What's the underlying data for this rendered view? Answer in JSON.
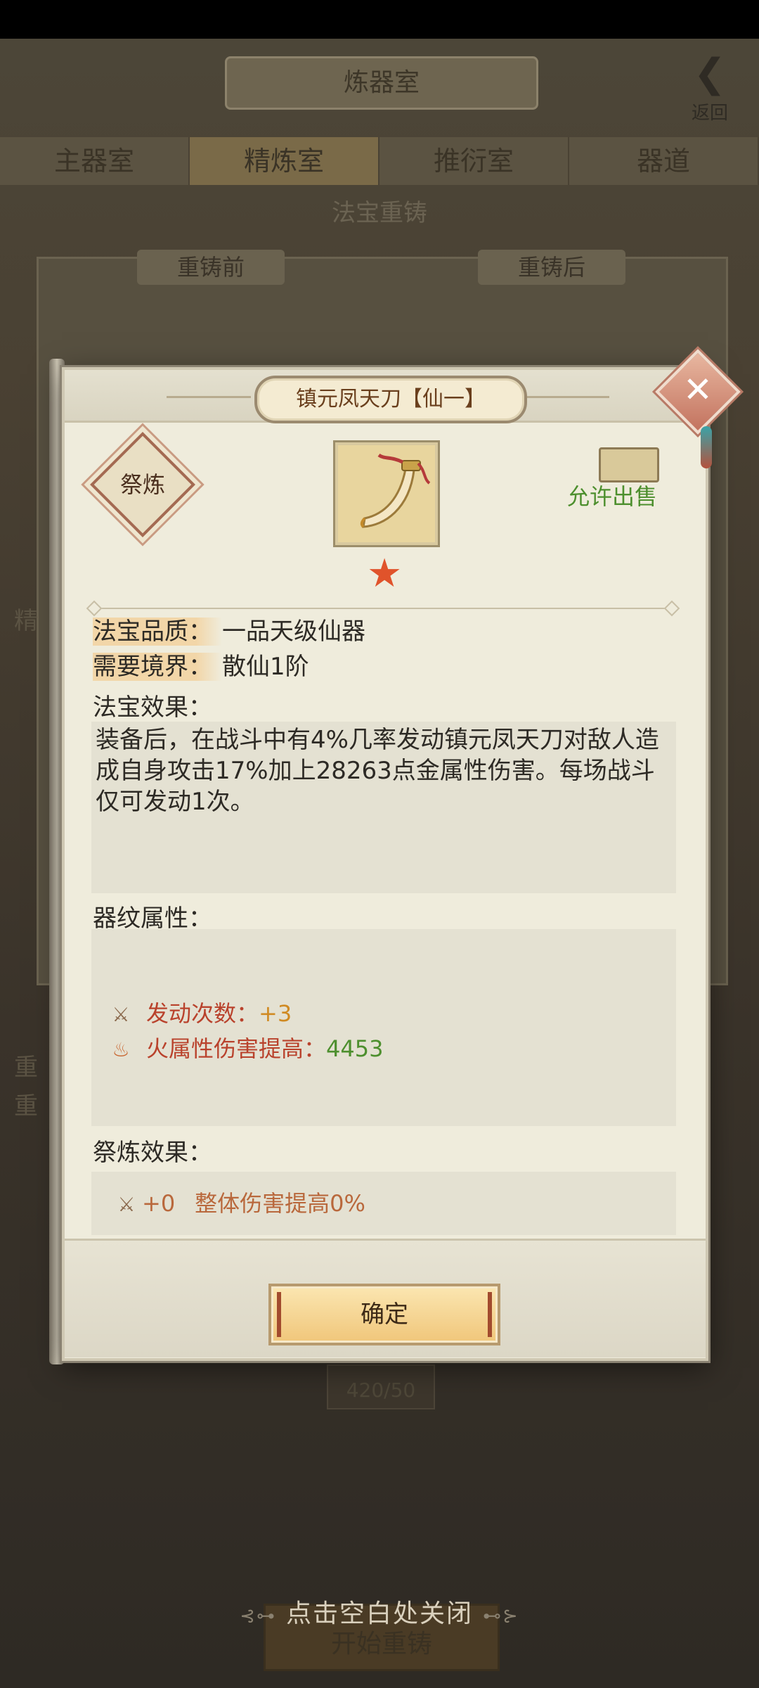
{
  "background": {
    "title": "炼器室",
    "back_label": "返回",
    "tabs": [
      {
        "label": "主器室"
      },
      {
        "label": "精炼室",
        "active": true
      },
      {
        "label": "推衍室"
      },
      {
        "label": "器道"
      }
    ],
    "section_title": "法宝重铸",
    "before_label": "重铸前",
    "after_label": "重铸后",
    "side_label": "精",
    "left_lines": [
      "重",
      "重"
    ],
    "counter": "420/50",
    "start_button": "开始重铸",
    "close_hint": "点击空白处关闭"
  },
  "dialog": {
    "title": "镇元凤天刀【仙一】",
    "refine_badge": "祭炼",
    "sell_status": "允许出售",
    "star_count": 1,
    "quality_label": "法宝品质：",
    "quality_value": "一品天级仙器",
    "realm_label": "需要境界：",
    "realm_value": "散仙1阶",
    "effect_heading": "法宝效果：",
    "effect_text": "装备后，在战斗中有4%几率发动镇元凤天刀对敌人造成自身攻击17%加上28263点金属性伤害。每场战斗仅可发动1次。",
    "pattern_heading": "器纹属性：",
    "pattern_attrs": [
      {
        "icon": "activation-icon",
        "name": "发动次数：",
        "value": "+3",
        "color": "#d08a22"
      },
      {
        "icon": "fire-icon",
        "name": "火属性伤害提高：",
        "value": "4453",
        "color": "#4d8f2e"
      }
    ],
    "refine_heading": "祭炼效果：",
    "refine_effect": {
      "icon": "activation-icon",
      "value": "+0",
      "name": "整体伤害提高0%"
    },
    "confirm_label": "确定"
  }
}
